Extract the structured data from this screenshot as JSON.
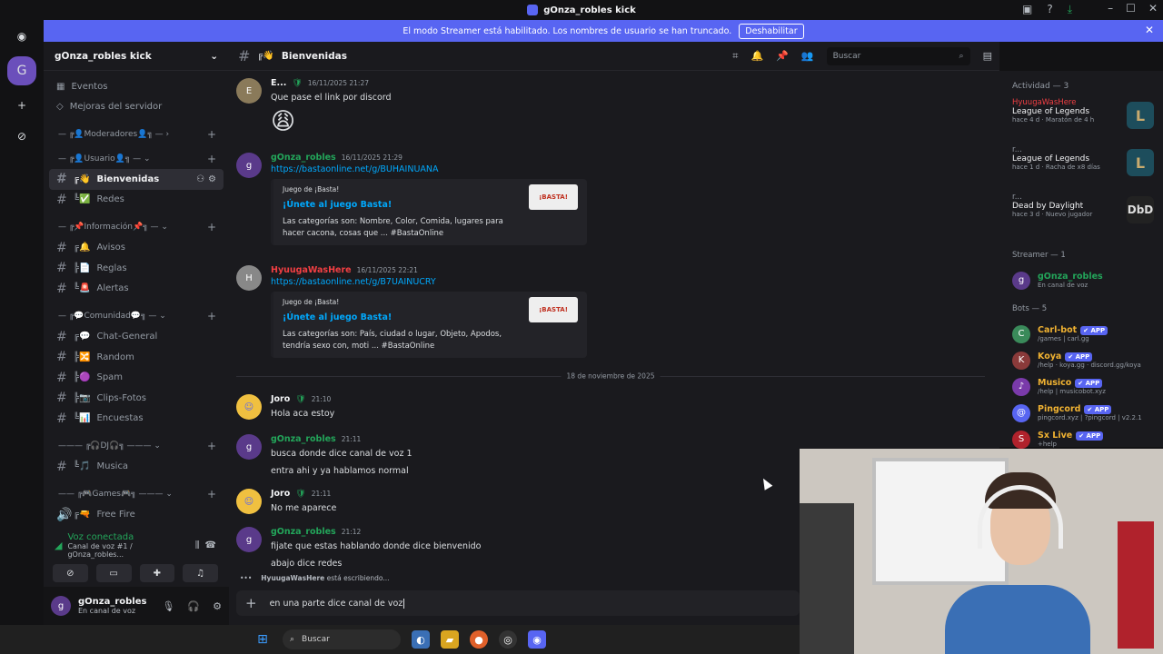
{
  "window": {
    "title": "gOnza_robles kick"
  },
  "banner": {
    "text": "El modo Streamer está habilitado. Los nombres de usuario se han truncado.",
    "button": "Deshabilitar"
  },
  "server": {
    "name": "gOnza_robles kick"
  },
  "sidebar": {
    "top_items": [
      {
        "label": "Eventos"
      },
      {
        "label": "Mejoras del servidor"
      }
    ],
    "categories": {
      "moderadores": "— ╔👤Moderadores👤╗ — ›",
      "usuario": "— ╔👤Usuario👤╗ — ⌄",
      "informacion": "— ╔📌Información📌╗ — ⌄",
      "comunidad": "— ╔💬Comunidad💬╗ — ⌄",
      "dj": "——— ╔🎧DJ🎧╗ ——— ⌄",
      "games": "—— ╔🎮Games🎮╗ ——— ⌄"
    },
    "channels": {
      "bienvenidas": "Bienvenidas",
      "redes": "Redes",
      "avisos": "Avisos",
      "reglas": "Reglas",
      "alertas": "Alertas",
      "chat_general": "Chat-General",
      "random": "Random",
      "spam": "Spam",
      "clips": "Clips-Fotos",
      "encuestas": "Encuestas",
      "musica": "Musica",
      "free_fire": "Free Fire"
    }
  },
  "voice": {
    "status": "Voz conectada",
    "channel": "Canal de voz #1 / gOnza_robles..."
  },
  "user": {
    "name": "gOnza_robles",
    "status": "En canal de voz"
  },
  "channel": {
    "name": "Bienvenidas",
    "search_placeholder": "Buscar"
  },
  "messages": [
    {
      "author": "E...",
      "timestamp": "16/11/2025 21:27",
      "text": "Que pase el link por discord",
      "emoji": "😩",
      "color": "#f2f3f5"
    },
    {
      "author": "gOnza_robles",
      "timestamp": "16/11/2025 21:29",
      "link": "https://bastaonline.net/g/BUHAINUANA",
      "color": "#23a55a",
      "embed": {
        "provider": "Juego de ¡Basta!",
        "title": "¡Únete al juego Basta!",
        "description": "Las categorías son: Nombre, Color, Comida, lugares para hacer cacona, cosas que ... #BastaOnline",
        "thumb": "¡BASTA!"
      }
    },
    {
      "author": "HyuugaWasHere",
      "timestamp": "16/11/2025 22:21",
      "link": "https://bastaonline.net/g/B7UAINUCRY",
      "color": "#f23f43",
      "embed": {
        "provider": "Juego de ¡Basta!",
        "title": "¡Únete al juego Basta!",
        "description": "Las categorías son: País, ciudad o lugar, Objeto, Apodos, tendría sexo con, moti ... #BastaOnline",
        "thumb": "¡BASTA!"
      }
    },
    {
      "author": "Joro",
      "timestamp": "21:10",
      "text": "Hola aca estoy",
      "color": "#f2f3f5"
    },
    {
      "author": "gOnza_robles",
      "timestamp": "21:11",
      "text": "busca donde dice canal de voz 1",
      "text2": "entra ahi y ya hablamos normal",
      "color": "#23a55a"
    },
    {
      "author": "Joro",
      "timestamp": "21:11",
      "text": "No me aparece",
      "color": "#f2f3f5"
    },
    {
      "author": "gOnza_robles",
      "timestamp": "21:12",
      "text": "fijate que estas hablando donde dice bienvenido",
      "text2": "abajo dice redes",
      "color": "#23a55a"
    }
  ],
  "date_divider": "18 de noviembre de 2025",
  "typing": {
    "user": "HyuugaWasHere",
    "suffix": "está escribiendo..."
  },
  "composer": {
    "value": "en una parte dice canal de voz"
  },
  "members": {
    "activity_title": "Actividad — 3",
    "activities": [
      {
        "user": "HyuugaWasHere",
        "game": "League of Legends",
        "sub": "hace 4 d  ·  Maratón de 4 h",
        "art": "L",
        "user_color": "#f23f43"
      },
      {
        "user": "r...",
        "game": "League of Legends",
        "sub": "hace 1 d  ·  Racha de x8 días",
        "art": "L",
        "user_color": "#949ba4"
      },
      {
        "user": "r...",
        "game": "Dead by Daylight",
        "sub": "hace 3 d  ·  Nuevo jugador",
        "art": "DbD",
        "user_color": "#949ba4"
      }
    ],
    "streamer_title": "Streamer — 1",
    "streamer": {
      "name": "gOnza_robles",
      "status": "En canal de voz"
    },
    "bots_title": "Bots — 5",
    "bots": [
      {
        "name": "Carl-bot",
        "status": "/games | carl.gg",
        "color": "#f0b232"
      },
      {
        "name": "Koya",
        "status": "/help · koya.gg · discord.gg/koya",
        "color": "#f0b232"
      },
      {
        "name": "Musico",
        "status": "/help | musicobot.xyz",
        "color": "#f0b232"
      },
      {
        "name": "Pingcord",
        "status": "pingcord.xyz | ?pingcord | v2.2.1",
        "color": "#f0b232"
      },
      {
        "name": "Sx Live",
        "status": "+help",
        "color": "#f0b232"
      }
    ],
    "app_label": "✔ APP"
  },
  "taskbar": {
    "search": "Buscar"
  }
}
